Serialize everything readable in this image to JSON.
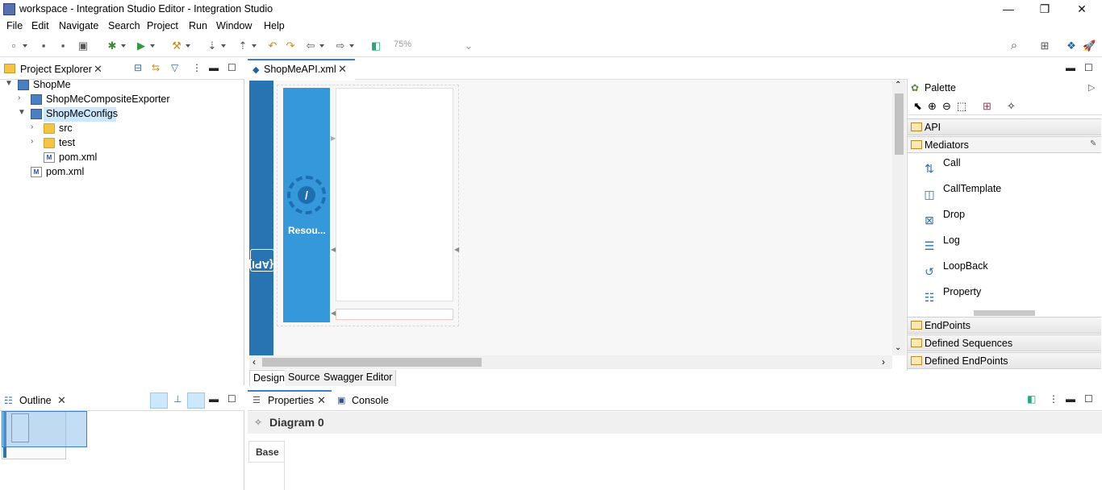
{
  "window": {
    "title": "workspace - Integration Studio Editor - Integration Studio",
    "minimize": "—",
    "restore": "❐",
    "close": "✕"
  },
  "menu": [
    "File",
    "Edit",
    "Navigate",
    "Search",
    "Project",
    "Run",
    "Window",
    "Help"
  ],
  "toolbar": {
    "zoom": "75%"
  },
  "project_explorer": {
    "tab": "Project Explorer",
    "items": [
      {
        "label": "ShopMe",
        "expanded": true
      },
      {
        "label": "ShopMeCompositeExporter",
        "expanded": false
      },
      {
        "label": "ShopMeConfigs",
        "expanded": true,
        "selected": true
      },
      {
        "label": "src",
        "expanded": false
      },
      {
        "label": "test",
        "expanded": false
      },
      {
        "label": "pom.xml"
      },
      {
        "label": "pom.xml"
      }
    ]
  },
  "editor": {
    "tab": "ShopMeAPI.xml",
    "api_label": "{API}",
    "resource_label": "Resou...",
    "bottom_tabs": [
      "Design",
      "Source",
      "Swagger Editor"
    ],
    "active_bottom_tab": "Design"
  },
  "palette": {
    "title": "Palette",
    "groups": {
      "api": "API",
      "mediators": "Mediators",
      "endpoints": "EndPoints",
      "defined_sequences": "Defined Sequences",
      "defined_endpoints": "Defined EndPoints"
    },
    "mediators": [
      "Call",
      "CallTemplate",
      "Drop",
      "Log",
      "LoopBack",
      "Property"
    ]
  },
  "outline": {
    "tab": "Outline"
  },
  "properties": {
    "tab": "Properties",
    "console_tab": "Console",
    "header": "Diagram 0",
    "side_tab": "Base"
  },
  "colors": {
    "accent": "#3498db",
    "api_bar": "#2874b2",
    "selection": "#cce8ff"
  }
}
